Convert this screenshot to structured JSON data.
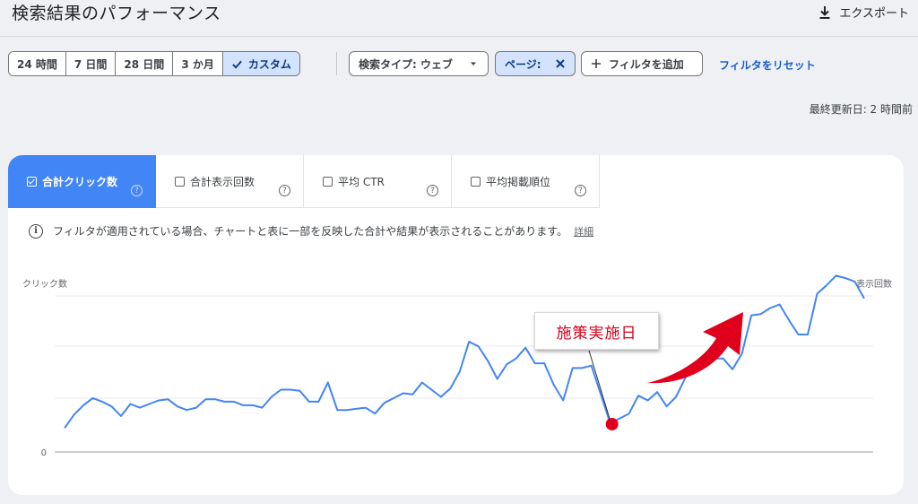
{
  "header": {
    "title": "検索結果のパフォーマンス",
    "export_label": "エクスポート"
  },
  "filters": {
    "date_ranges": [
      {
        "label": "24 時間",
        "active": false
      },
      {
        "label": "7 日間",
        "active": false
      },
      {
        "label": "28 日間",
        "active": false
      },
      {
        "label": "3 か月",
        "active": false
      },
      {
        "label": "カスタム",
        "active": true
      }
    ],
    "search_type_label": "検索タイプ: ウェブ",
    "page_label": "ページ:",
    "add_filter_label": "フィルタを追加",
    "reset_label": "フィルタをリセット"
  },
  "last_updated": "最終更新日: 2 時間前",
  "metrics": {
    "tabs": [
      {
        "label": "合計クリック数",
        "active": true
      },
      {
        "label": "合計表示回数",
        "active": false
      },
      {
        "label": "平均 CTR",
        "active": false
      },
      {
        "label": "平均掲載順位",
        "active": false
      }
    ],
    "help_glyph": "?"
  },
  "notice": {
    "icon": "i",
    "text": "フィルタが適用されている場合、チャートと表に一部を反映した合計や結果が表示されることがあります。",
    "link": "詳細"
  },
  "chart_data": {
    "type": "line",
    "ylabel_left": "クリック数",
    "ylabel_right": "表示回数",
    "y_ticks": [
      "0"
    ],
    "ylim": [
      0,
      100
    ],
    "grid": true,
    "series": [
      {
        "color": "#4285f4",
        "values": [
          8,
          19,
          27,
          33,
          30,
          26,
          18,
          28,
          25,
          28,
          31,
          32,
          26,
          23,
          25,
          32,
          32,
          30,
          30,
          27,
          27,
          25,
          34,
          40,
          40,
          39,
          30,
          30,
          46,
          23,
          23,
          24,
          25,
          20,
          29,
          33,
          37,
          36,
          46,
          40,
          34,
          41,
          55,
          80,
          76,
          64,
          49,
          61,
          66,
          75,
          62,
          62,
          44,
          31,
          58,
          58,
          60,
          36,
          12,
          16,
          20,
          35,
          31,
          38,
          26,
          34,
          50,
          62,
          60,
          66,
          66,
          57,
          70,
          102,
          103,
          108,
          111,
          98,
          86,
          86,
          120,
          127,
          135,
          133,
          130,
          116
        ]
      }
    ],
    "annotation": {
      "label": "施策実施日",
      "point_index": 58,
      "marker_color": "#e0001b",
      "arrow_color": "#e0001b"
    }
  }
}
